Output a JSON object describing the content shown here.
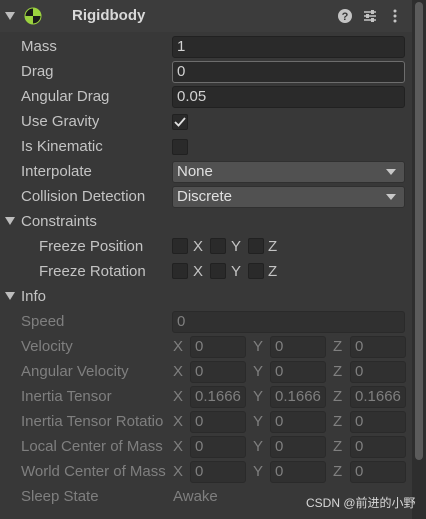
{
  "component": {
    "title": "Rigidbody"
  },
  "properties": {
    "mass": {
      "label": "Mass",
      "value": "1"
    },
    "drag": {
      "label": "Drag",
      "value": "0"
    },
    "angular_drag": {
      "label": "Angular Drag",
      "value": "0.05"
    },
    "use_gravity": {
      "label": "Use Gravity",
      "checked": true
    },
    "is_kinematic": {
      "label": "Is Kinematic",
      "checked": false
    },
    "interpolate": {
      "label": "Interpolate",
      "value": "None"
    },
    "collision_detection": {
      "label": "Collision Detection",
      "value": "Discrete"
    }
  },
  "constraints": {
    "label": "Constraints",
    "freeze_position": {
      "label": "Freeze Position",
      "x": "X",
      "y": "Y",
      "z": "Z"
    },
    "freeze_rotation": {
      "label": "Freeze Rotation",
      "x": "X",
      "y": "Y",
      "z": "Z"
    }
  },
  "info": {
    "label": "Info",
    "speed": {
      "label": "Speed",
      "value": "0"
    },
    "velocity": {
      "label": "Velocity",
      "x": "0",
      "y": "0",
      "z": "0"
    },
    "angular_velocity": {
      "label": "Angular Velocity",
      "x": "0",
      "y": "0",
      "z": "0"
    },
    "inertia_tensor": {
      "label": "Inertia Tensor",
      "x": "0.1666",
      "y": "0.1666",
      "z": "0.1666"
    },
    "inertia_tensor_rotation": {
      "label": "Inertia Tensor Rotatio",
      "x": "0",
      "y": "0",
      "z": "0"
    },
    "local_center_of_mass": {
      "label": "Local Center of Mass",
      "x": "0",
      "y": "0",
      "z": "0"
    },
    "world_center_of_mass": {
      "label": "World Center of Mass",
      "x": "0",
      "y": "0",
      "z": "0"
    },
    "sleep_state": {
      "label": "Sleep State",
      "value": "Awake"
    }
  },
  "axis_labels": {
    "x": "X",
    "y": "Y",
    "z": "Z"
  },
  "watermark": "CSDN @前进的小野",
  "colors": {
    "background": "#383838",
    "field": "#2a2a2a",
    "dropdown": "#515151"
  }
}
